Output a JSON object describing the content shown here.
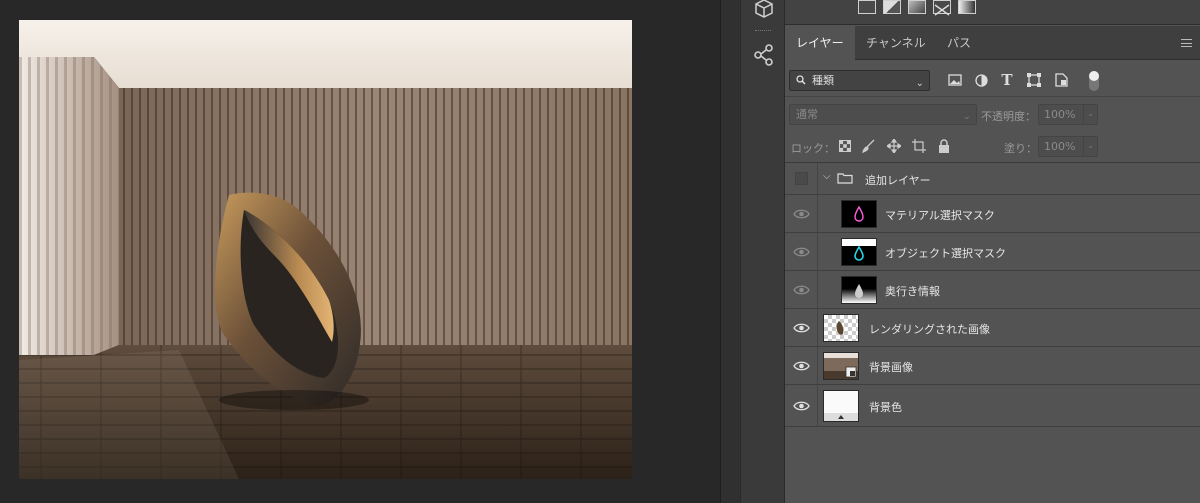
{
  "panel": {
    "tabs": [
      {
        "label": "レイヤー",
        "active": true
      },
      {
        "label": "チャンネル",
        "active": false
      },
      {
        "label": "パス",
        "active": false
      }
    ],
    "filter": {
      "selected": "種類"
    },
    "blend": {
      "mode": "通常",
      "opacity_label": "不透明度：",
      "opacity": "100%"
    },
    "lock": {
      "label": "ロック：",
      "fill_label": "塗り：",
      "fill": "100%"
    },
    "layers": [
      {
        "name": "追加レイヤー",
        "type": "group",
        "visible": false
      },
      {
        "name": "マテリアル選択マスク",
        "type": "mask-pink",
        "visible": true,
        "dim": true
      },
      {
        "name": "オブジェクト選択マスク",
        "type": "mask-cyan",
        "visible": true,
        "dim": true
      },
      {
        "name": "奥行き情報",
        "type": "depth",
        "visible": true,
        "dim": true
      },
      {
        "name": "レンダリングされた画像",
        "type": "render",
        "visible": true
      },
      {
        "name": "背景画像",
        "type": "bg-image",
        "visible": true
      },
      {
        "name": "背景色",
        "type": "bg-color",
        "visible": true
      }
    ]
  },
  "icons": {
    "toolstrip": [
      "3d-cube-icon",
      "share-icon"
    ],
    "filter": [
      "image-filter-icon",
      "adjustment-filter-icon",
      "type-filter-icon",
      "shape-filter-icon",
      "smart-object-filter-icon"
    ],
    "lock": [
      "lock-transparent-icon",
      "lock-image-icon",
      "lock-position-icon",
      "lock-artboard-icon",
      "lock-all-icon"
    ]
  },
  "colors": {
    "panel_bg": "#535353",
    "tab_bar": "#3f3f3f",
    "canvas_bg": "#282828"
  }
}
